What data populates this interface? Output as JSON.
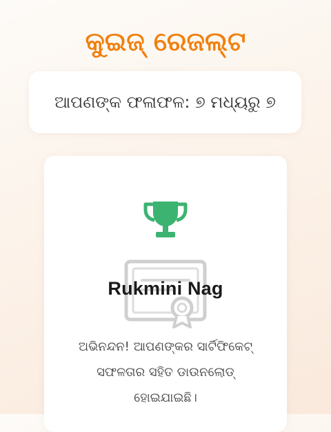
{
  "header": {
    "title": "କୁଇଜ୍ ରେଜଲ୍ଟ"
  },
  "score": {
    "text": "ଆପଣଙ୍କ ଫଳାଫଳ: ୭ ମଧ୍ୟରୁ ୭"
  },
  "certificate": {
    "icon": "trophy-icon",
    "watermark_icon": "certificate-icon",
    "recipient_name": "Rukmini Nag",
    "message": "ଅଭିନନ୍ଦନ! ଆପଣଙ୍କର ସାର୍ଟିଫିକେଟ୍ ସଫଳତାର ସହିତ ଡାଉନଲୋଡ୍ ହୋଇଯାଇଛି।"
  },
  "colors": {
    "accent": "#f0800f",
    "trophy": "#3cb371",
    "watermark": "#cfcfcf"
  }
}
